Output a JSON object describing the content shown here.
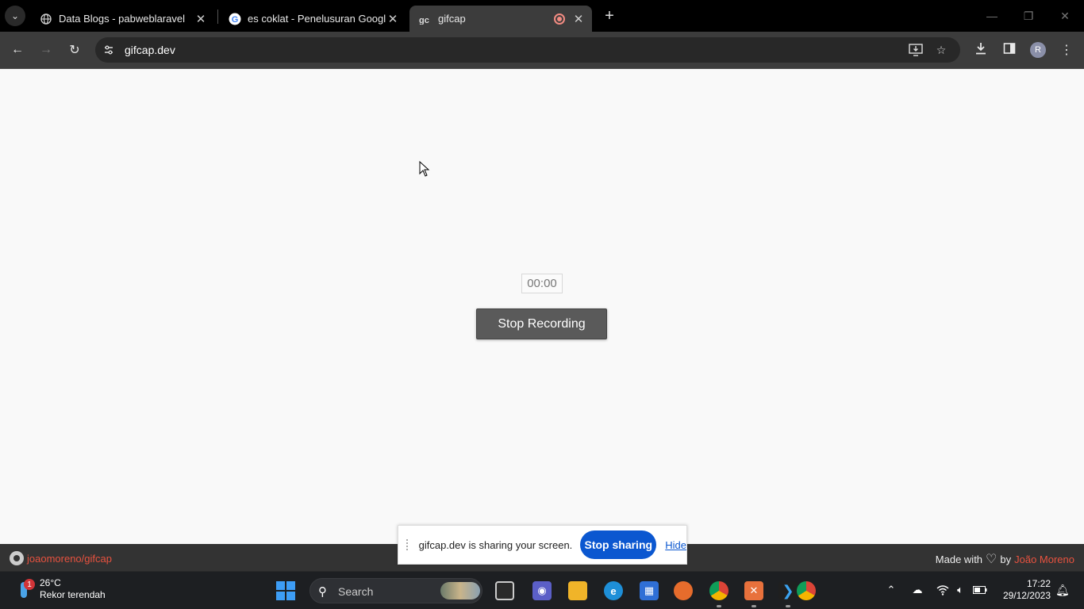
{
  "browser": {
    "tabs": [
      {
        "title": "Data Blogs - pabweblaravel",
        "icon": "globe-icon"
      },
      {
        "title": "es coklat - Penelusuran Google",
        "icon": "google-icon"
      },
      {
        "title": "gifcap",
        "icon": "gifcap-icon",
        "recording": true
      }
    ],
    "url": "gifcap.dev",
    "profile_initial": "R"
  },
  "page": {
    "timer": "00:00",
    "stop_recording_label": "Stop Recording"
  },
  "footer": {
    "repo_link": "joaomoreno/gifcap",
    "made_with": "Made with",
    "by": "by",
    "author": "João Moreno"
  },
  "sharebar": {
    "message": "gifcap.dev is sharing your screen.",
    "stop_label": "Stop sharing",
    "hide_label": "Hide",
    "accent": "#0b57d0"
  },
  "taskbar": {
    "weather_badge": "1",
    "temperature": "26°C",
    "weather_desc": "Rekor terendah",
    "search_placeholder": "Search",
    "time": "17:22",
    "date": "29/12/2023"
  }
}
